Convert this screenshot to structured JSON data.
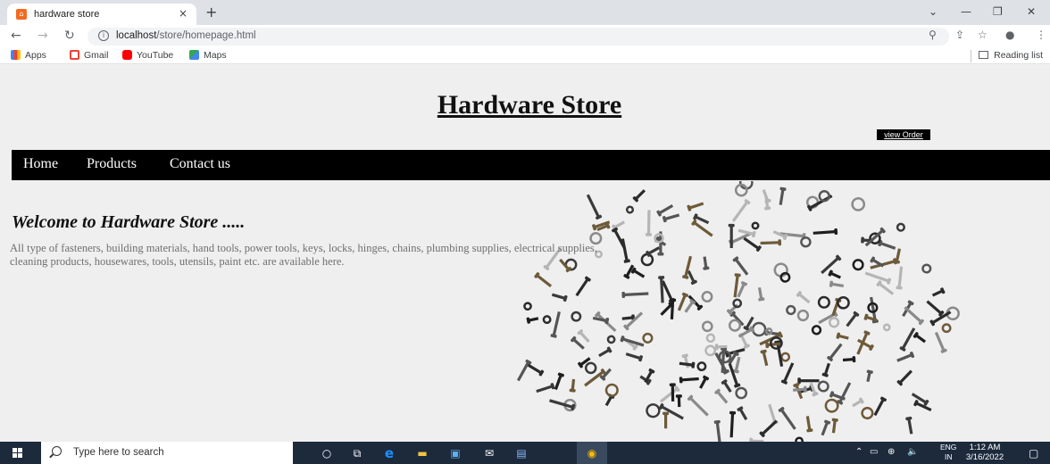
{
  "browser": {
    "tab_title": "hardware store",
    "tab_close": "×",
    "new_tab": "+",
    "url_host": "localhost",
    "url_path": "/store/homepage.html",
    "bookmarks": [
      "Apps",
      "Gmail",
      "YouTube",
      "Maps"
    ],
    "reading_list": "Reading list"
  },
  "site": {
    "title": "Hardware Store",
    "view_order_label": "view Order",
    "nav": [
      "Home",
      "Products",
      "Contact us"
    ],
    "welcome": "Welcome to Hardware Store .....",
    "description": "All type of fasteners, building materials, hand tools, power tools, keys, locks, hinges, chains, plumbing supplies, electrical supplies, cleaning products, housewares, tools, utensils, paint etc. are available here."
  },
  "taskbar": {
    "search_placeholder": "Type here to search",
    "lang_top": "ENG",
    "lang_bottom": "IN",
    "time": "1:12 AM",
    "date": "3/16/2022"
  },
  "colors": {
    "nav_bg": "#000000",
    "taskbar_bg": "#1c2a3c",
    "edge_blue": "#1e90ff"
  }
}
